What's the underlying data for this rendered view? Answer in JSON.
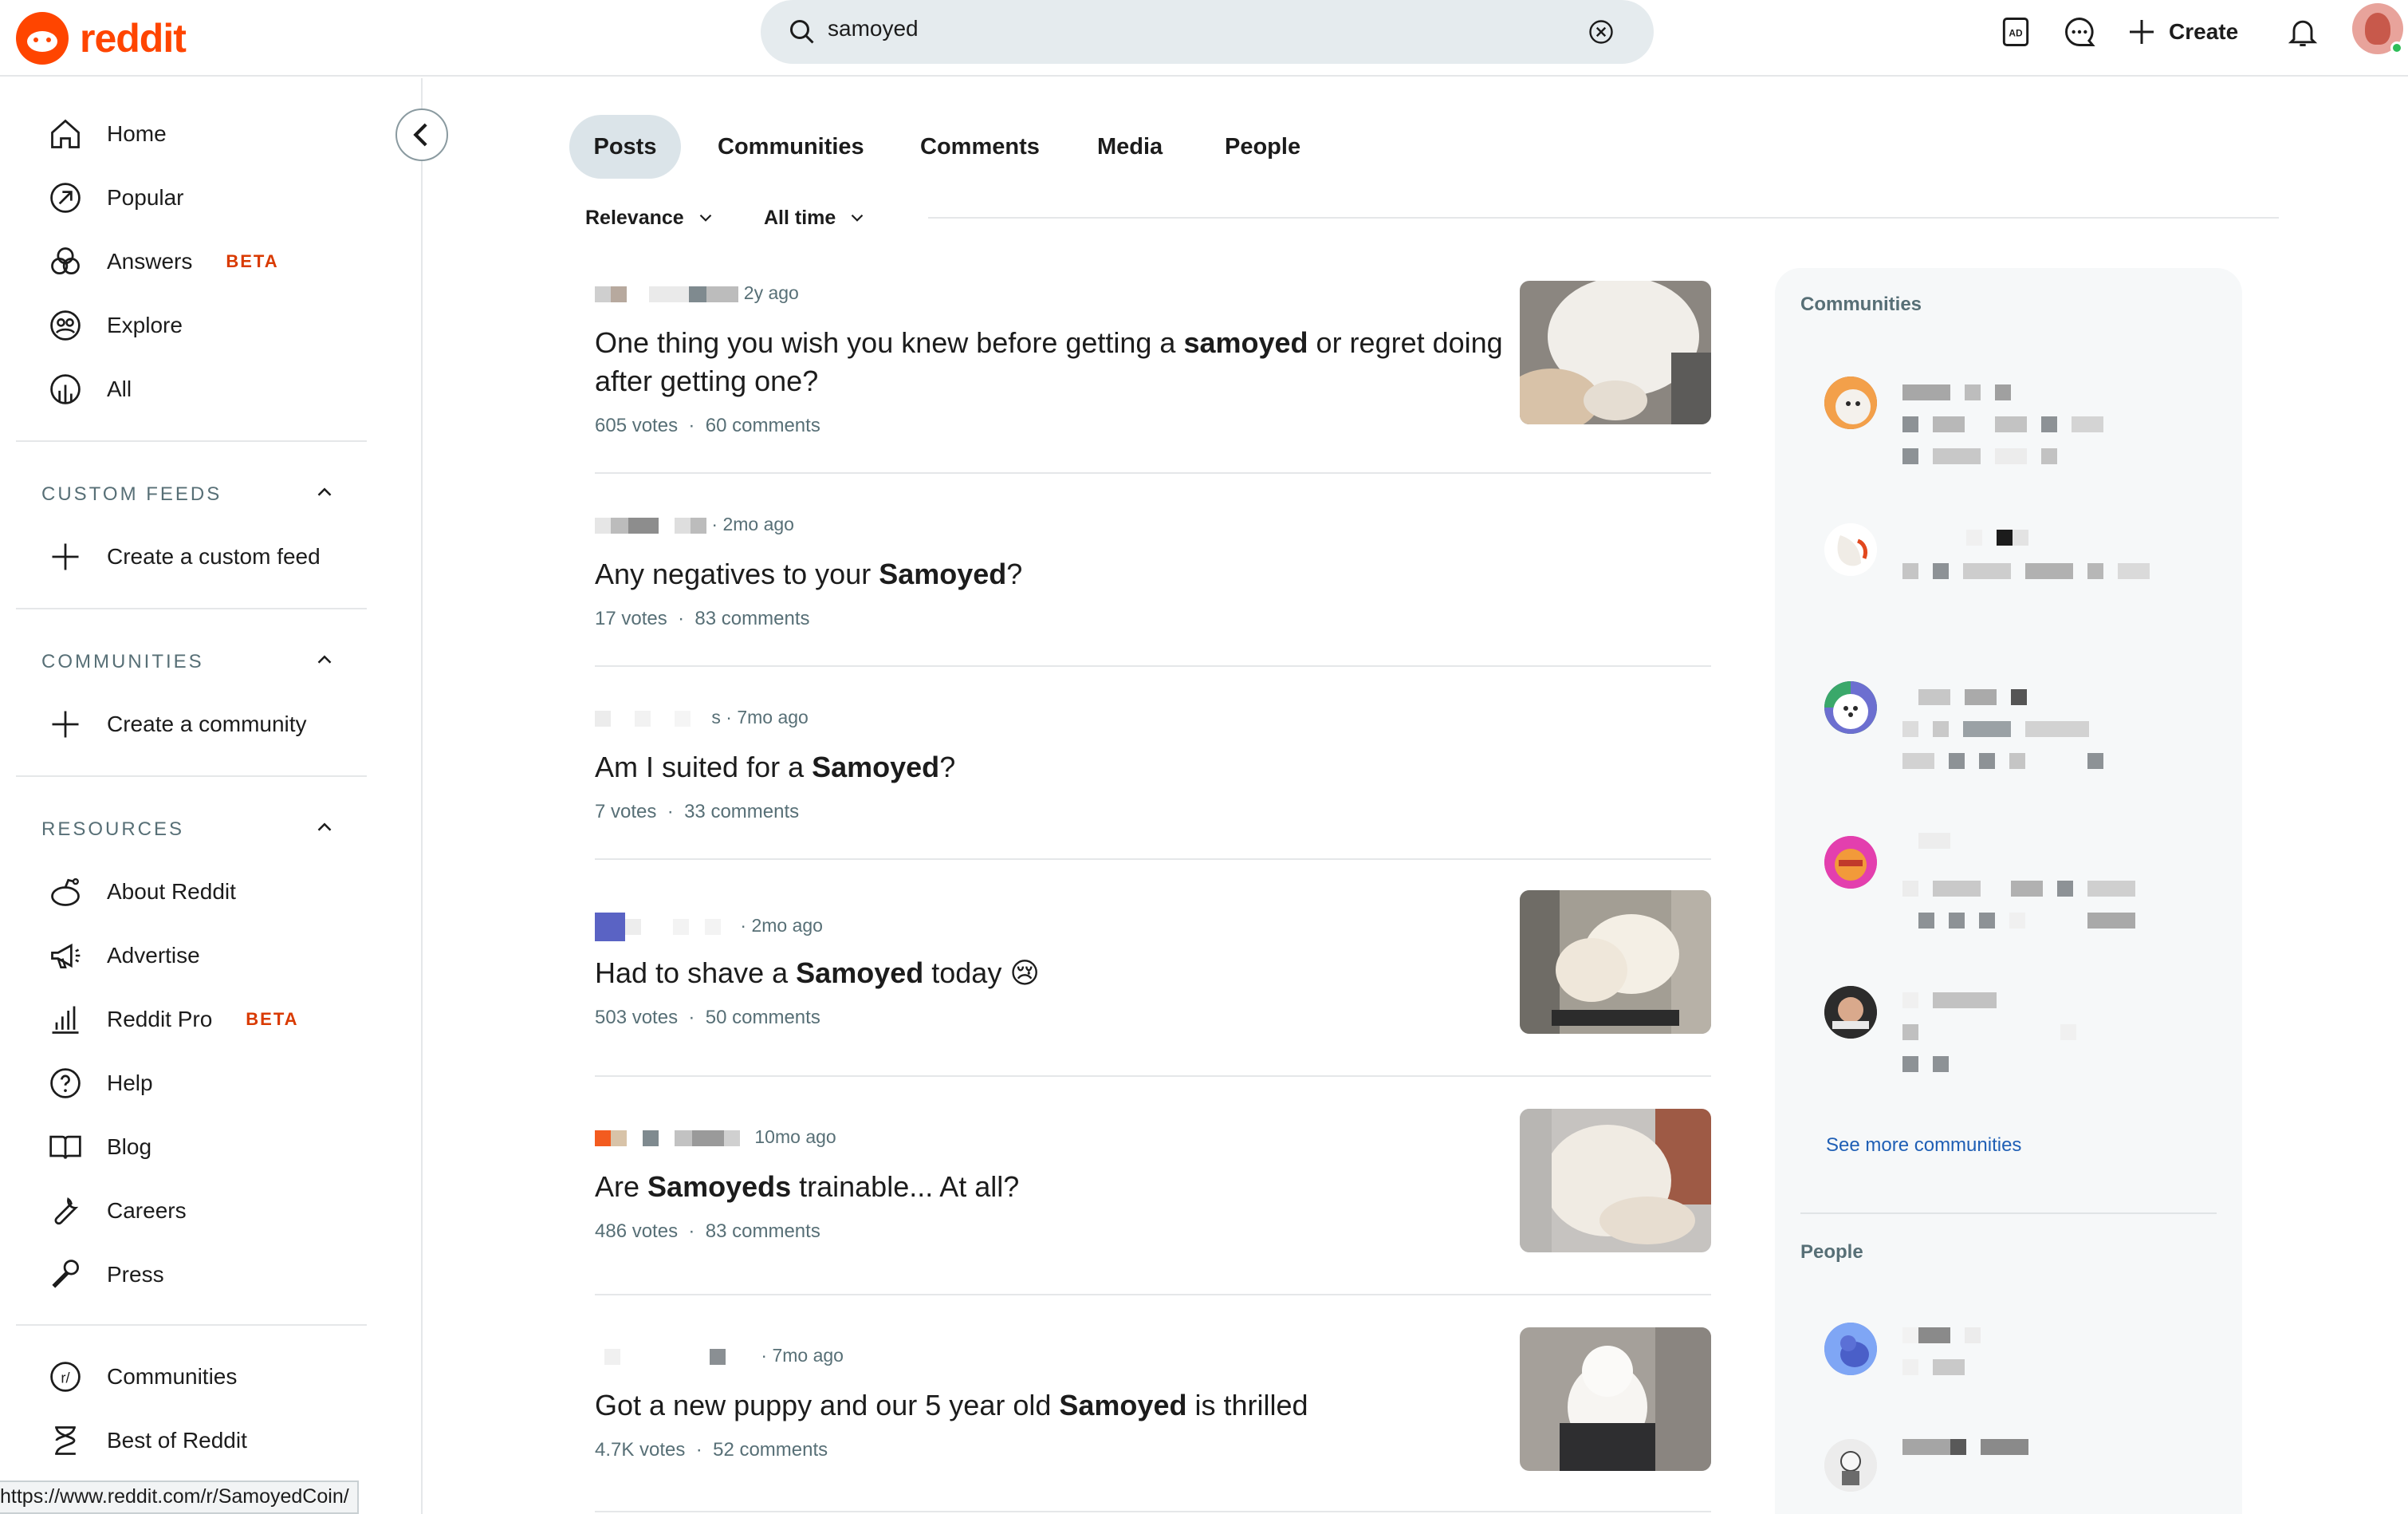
{
  "header": {
    "brand": "reddit",
    "search_value": "samoyed",
    "create_label": "Create"
  },
  "sidebar": {
    "primary": [
      {
        "label": "Home",
        "icon": "home-icon"
      },
      {
        "label": "Popular",
        "icon": "popular-icon"
      },
      {
        "label": "Answers",
        "badge": "BETA",
        "icon": "answers-icon"
      },
      {
        "label": "Explore",
        "icon": "explore-icon"
      },
      {
        "label": "All",
        "icon": "all-icon"
      }
    ],
    "custom_feeds": {
      "title": "CUSTOM FEEDS",
      "action": "Create a custom feed"
    },
    "communities": {
      "title": "COMMUNITIES",
      "action": "Create a community"
    },
    "resources": {
      "title": "RESOURCES",
      "items": [
        {
          "label": "About Reddit",
          "icon": "reddit-alien-icon"
        },
        {
          "label": "Advertise",
          "icon": "megaphone-icon"
        },
        {
          "label": "Reddit Pro",
          "badge": "BETA",
          "icon": "bar-chart-icon"
        },
        {
          "label": "Help",
          "icon": "help-icon"
        },
        {
          "label": "Blog",
          "icon": "book-icon"
        },
        {
          "label": "Careers",
          "icon": "wrench-icon"
        },
        {
          "label": "Press",
          "icon": "microphone-icon"
        }
      ]
    },
    "footer": [
      {
        "label": "Communities",
        "icon": "communities-icon"
      },
      {
        "label": "Best of Reddit",
        "icon": "hourglass-icon"
      }
    ],
    "status_url": "https://www.reddit.com/r/SamoyedCoin/"
  },
  "tabs": [
    "Posts",
    "Communities",
    "Comments",
    "Media",
    "People"
  ],
  "filters": {
    "sort": "Relevance",
    "time": "All time"
  },
  "posts": [
    {
      "time": "2y ago",
      "title_pre": "One thing you wish you knew before getting a ",
      "title_bold": "samoyed",
      "title_post": " or regret doing after getting one?",
      "votes": "605 votes",
      "comments": "60 comments"
    },
    {
      "time": "· 2mo ago",
      "title_pre": "Any negatives to your ",
      "title_bold": "Samoyed",
      "title_post": "?",
      "votes": "17 votes",
      "comments": "83 comments"
    },
    {
      "time": "s · 7mo ago",
      "title_pre": "Am I suited for a ",
      "title_bold": "Samoyed",
      "title_post": "?",
      "votes": "7 votes",
      "comments": "33 comments"
    },
    {
      "time": "· 2mo ago",
      "title_pre": "Had to shave a ",
      "title_bold": "Samoyed",
      "title_post": " today 😢",
      "votes": "503 votes",
      "comments": "50 comments"
    },
    {
      "time": "10mo ago",
      "title_pre": "Are ",
      "title_bold": "Samoyeds",
      "title_post": " trainable... At all?",
      "votes": "486 votes",
      "comments": "83 comments"
    },
    {
      "time": "· 7mo ago",
      "title_pre": "Got a new puppy and our 5 year old ",
      "title_bold": "Samoyed",
      "title_post": " is thrilled",
      "votes": "4.7K votes",
      "comments": "52 comments"
    }
  ],
  "stat_separator": "·",
  "right_panel": {
    "communities_title": "Communities",
    "see_more": "See more communities",
    "people_title": "People"
  },
  "colors": {
    "brand": "#ff4500",
    "beta": "#d93a00",
    "link": "#1f5fb5",
    "active_tab": "#dbe4e9"
  }
}
